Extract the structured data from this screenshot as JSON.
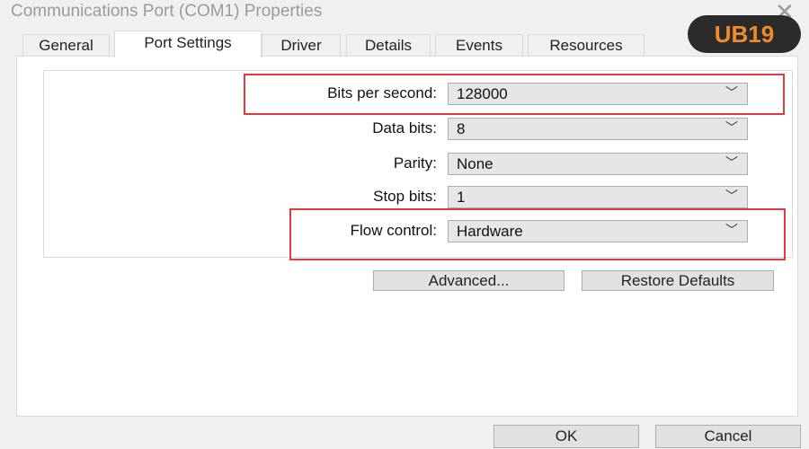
{
  "window": {
    "title": "Communications Port (COM1) Properties",
    "close_icon": "close-icon"
  },
  "logo": {
    "text": "UB19"
  },
  "tabs": [
    {
      "label": "General"
    },
    {
      "label": "Port Settings",
      "active": true
    },
    {
      "label": "Driver"
    },
    {
      "label": "Details"
    },
    {
      "label": "Events"
    },
    {
      "label": "Resources"
    }
  ],
  "fields": [
    {
      "label": "Bits per second:",
      "value": "128000",
      "highlighted": true
    },
    {
      "label": "Data bits:",
      "value": "8"
    },
    {
      "label": "Parity:",
      "value": "None"
    },
    {
      "label": "Stop bits:",
      "value": "1"
    },
    {
      "label": "Flow control:",
      "value": "Hardware",
      "highlighted": true
    }
  ],
  "buttons": {
    "advanced": "Advanced...",
    "restore": "Restore Defaults",
    "ok": "OK",
    "cancel": "Cancel"
  },
  "colors": {
    "highlight": "#e23b3b"
  }
}
